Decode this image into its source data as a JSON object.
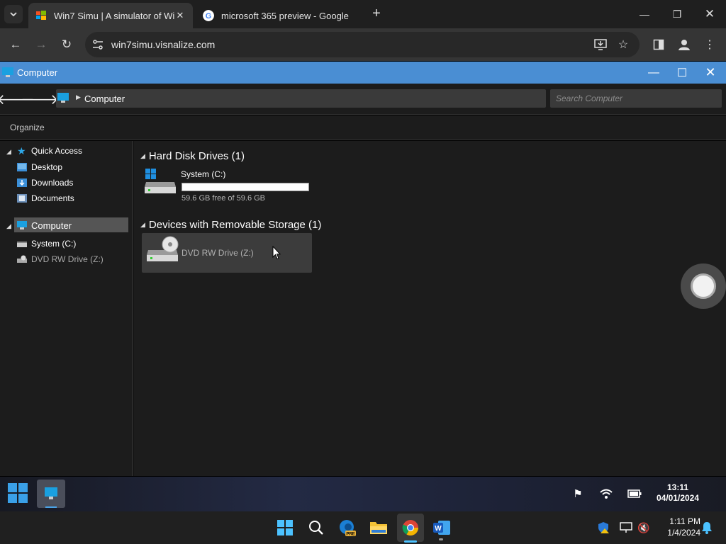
{
  "browser": {
    "tabs": [
      {
        "title": "Win7 Simu | A simulator of Win",
        "active": true
      },
      {
        "title": "microsoft 365 preview - Google",
        "active": false
      }
    ],
    "url": "win7simu.visnalize.com"
  },
  "window": {
    "title": "Computer",
    "address": "Computer",
    "search_placeholder": "Search Computer",
    "organize_label": "Organize"
  },
  "nav": {
    "quick_access": "Quick Access",
    "desktop": "Desktop",
    "downloads": "Downloads",
    "documents": "Documents",
    "computer": "Computer",
    "system_c": "System (C:)",
    "dvd": "DVD RW Drive (Z:)"
  },
  "content": {
    "hdd_header": "Hard Disk Drives (1)",
    "removable_header": "Devices with Removable Storage (1)",
    "system_drive": {
      "name": "System (C:)",
      "free_text": "59.6 GB free of 59.6 GB",
      "used_fraction": 0.0
    },
    "dvd_drive": {
      "name": "DVD RW Drive (Z:)"
    }
  },
  "win7_taskbar": {
    "time": "13:11",
    "date": "04/01/2024"
  },
  "win11_taskbar": {
    "time": "1:11 PM",
    "date": "1/4/2024"
  },
  "colors": {
    "titlebar": "#4a8ed3",
    "bar_fill": "#26a0da",
    "selection": "#555555"
  }
}
